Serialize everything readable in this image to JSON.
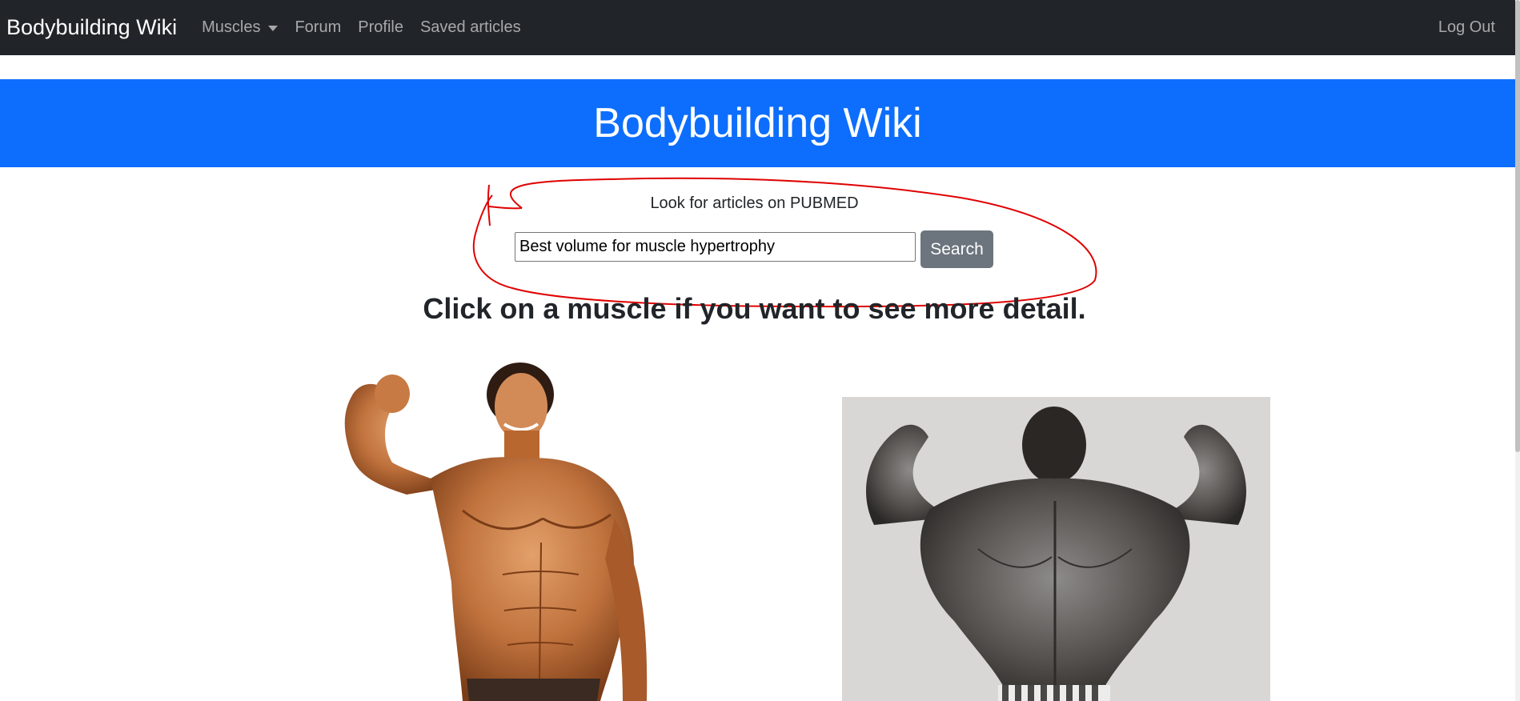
{
  "navbar": {
    "brand": "Bodybuilding Wiki",
    "items": [
      {
        "label": "Muscles",
        "dropdown": true
      },
      {
        "label": "Forum"
      },
      {
        "label": "Profile"
      },
      {
        "label": "Saved articles"
      }
    ],
    "logout": "Log Out"
  },
  "hero": {
    "title": "Bodybuilding Wiki"
  },
  "search": {
    "caption": "Look for articles on PUBMED",
    "value": "Best volume for muscle hypertrophy",
    "button": "Search"
  },
  "main": {
    "heading": "Click on a muscle if you want to see more detail."
  },
  "colors": {
    "navbar_bg": "#212529",
    "hero_bg": "#0d6efd",
    "button_bg": "#6c757d",
    "annotation": "#e00000"
  }
}
